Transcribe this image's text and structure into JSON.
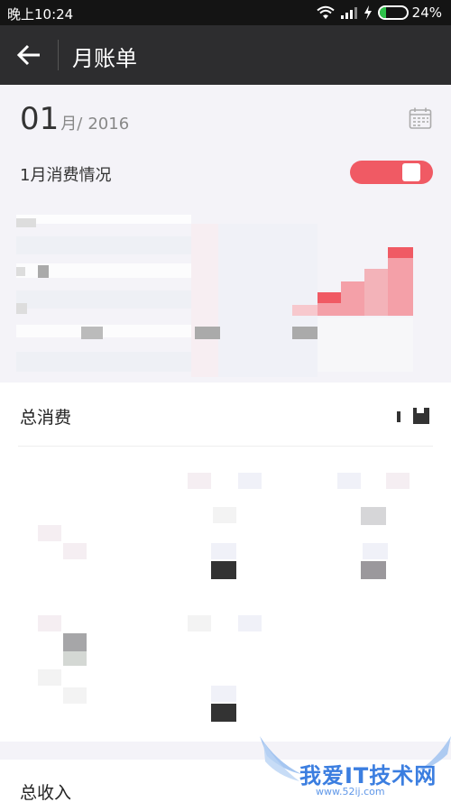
{
  "status": {
    "time": "晚上10:24",
    "battery_pct": "24%",
    "battery_level": 0.24,
    "battery_color": "#2ec24a"
  },
  "appbar": {
    "title": "月账单"
  },
  "header": {
    "month": "01",
    "month_unit": "月/",
    "year": "2016"
  },
  "section": {
    "title": "1月消费情况"
  },
  "summary": {
    "total_expense_label": "总消费",
    "total_income_label": "总收入"
  },
  "watermark": {
    "text": "我爱IT技术网",
    "url": "www.52ij.com"
  },
  "colors": {
    "accent": "#f05a64",
    "appbar_bg": "#2d2d2f",
    "page_bg": "#f4f3f8"
  },
  "icons": [
    "back-arrow-icon",
    "calendar-icon",
    "wifi-icon",
    "signal-icon",
    "charging-icon"
  ]
}
